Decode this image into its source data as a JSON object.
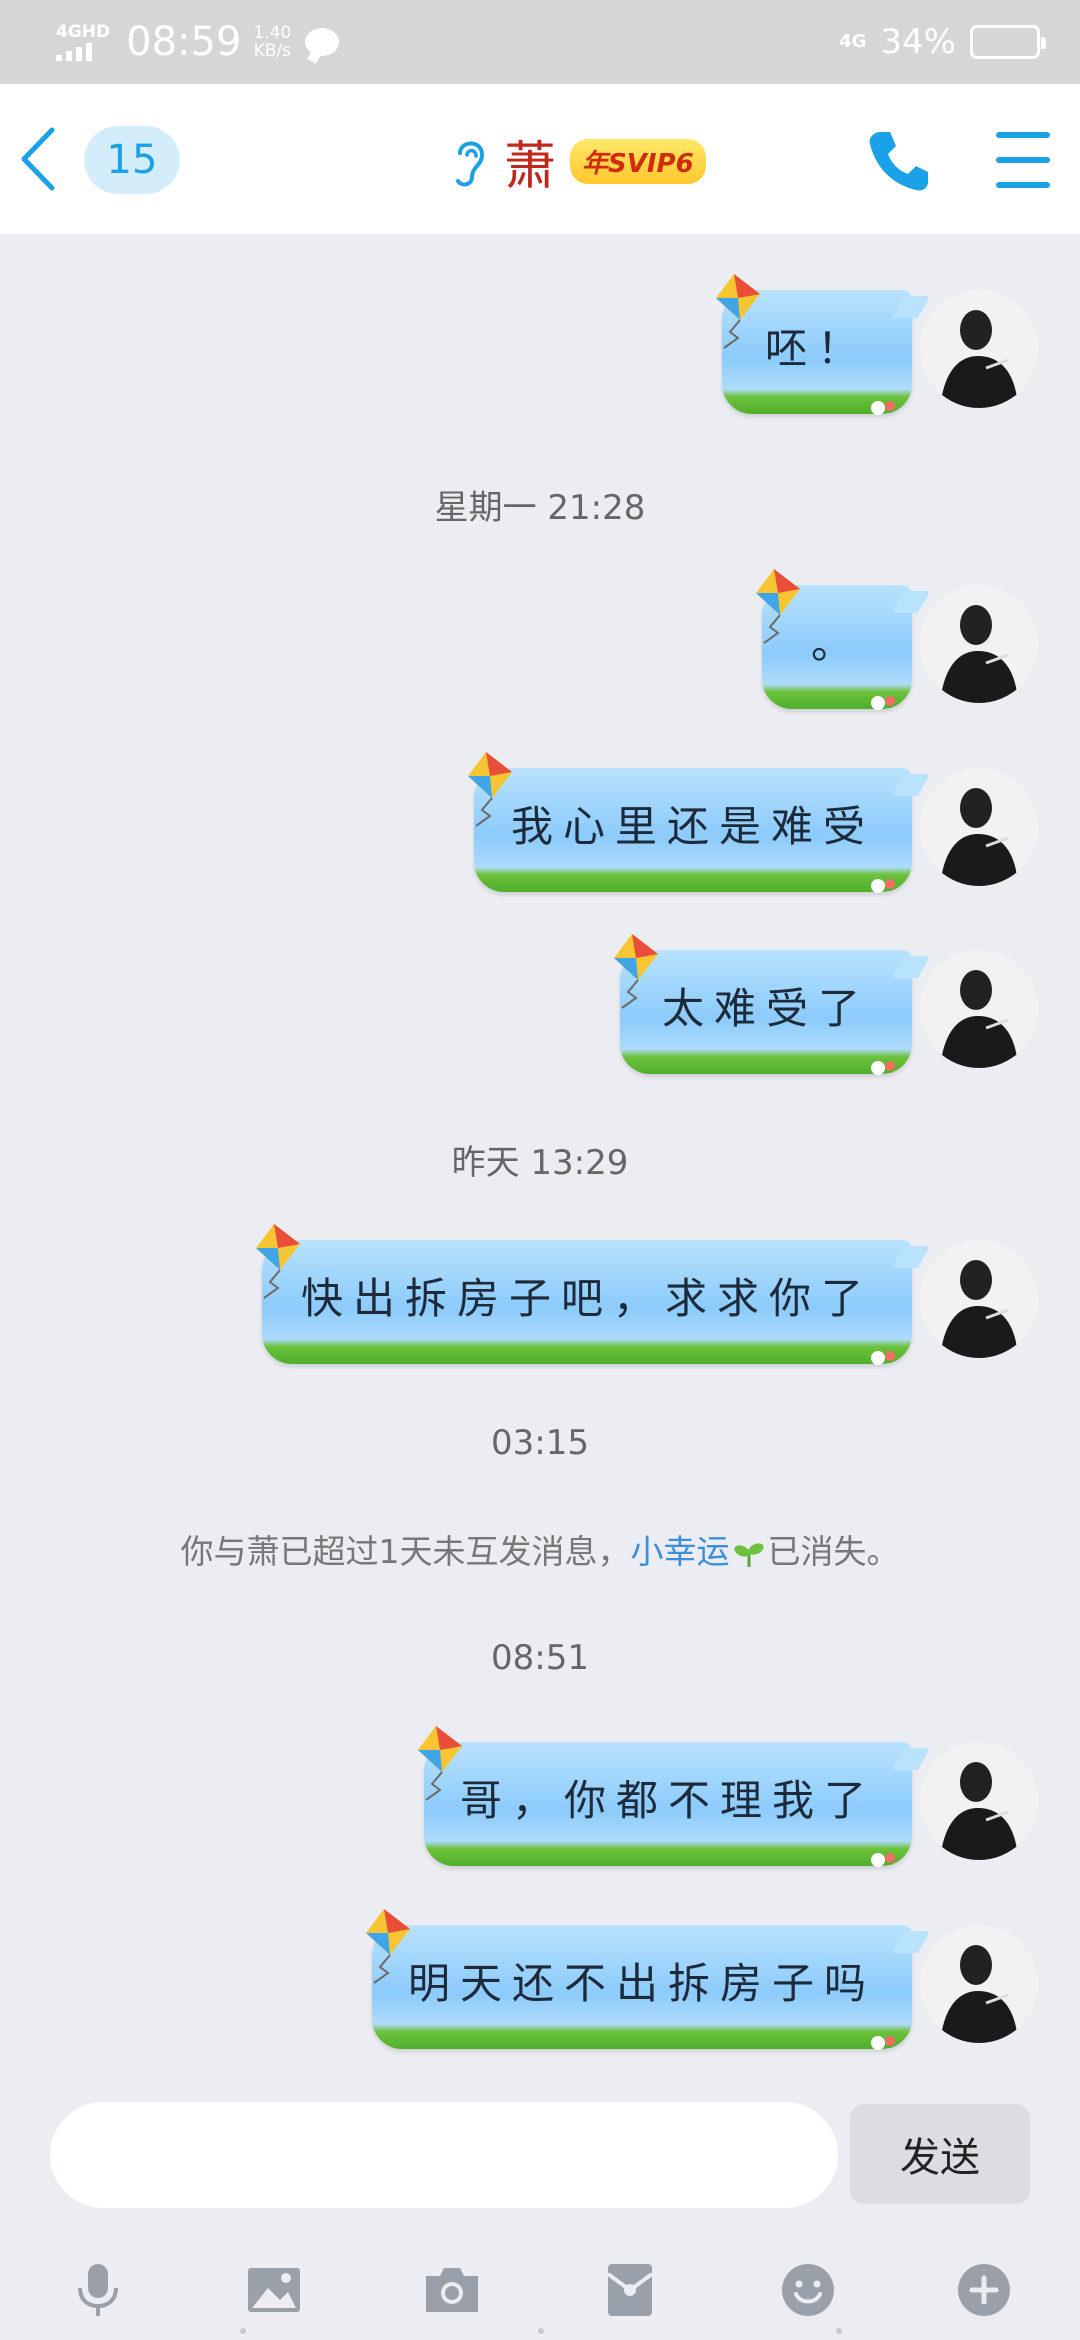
{
  "status_bar": {
    "network": "4GHD",
    "time": "08:59",
    "speed_value": "1.40",
    "speed_unit": "KB/s",
    "network_right": "4G",
    "battery_percent": "34%",
    "battery_level": 0.34
  },
  "header": {
    "unread_count": "15",
    "contact_name": "萧",
    "vip_label": "年SVIP6",
    "accent_color": "#1aa1e7"
  },
  "messages": [
    {
      "text": "呸！"
    },
    {
      "text": "。"
    },
    {
      "text": "我心里还是难受"
    },
    {
      "text": "太难受了"
    },
    {
      "text": "快出拆房子吧，求求你了"
    },
    {
      "text": "哥，你都不理我了"
    },
    {
      "text": "明天还不出拆房子吗"
    }
  ],
  "timestamps": [
    "星期一 21:28",
    "昨天 13:29",
    "03:15",
    "08:51"
  ],
  "system_note": {
    "prefix": "你与萧已超过1天未互发消息，",
    "link": "小幸运",
    "suffix": "已消失。"
  },
  "input": {
    "value": "",
    "send_label": "发送"
  },
  "toolbar_icons": [
    "microphone-icon",
    "image-icon",
    "camera-icon",
    "red-packet-icon",
    "emoji-icon",
    "plus-icon"
  ]
}
